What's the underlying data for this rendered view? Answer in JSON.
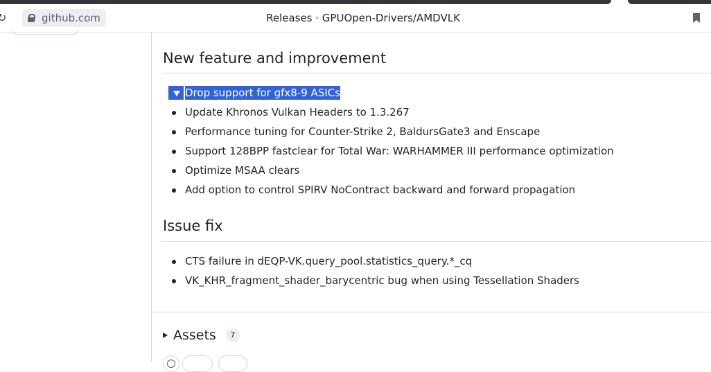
{
  "browser": {
    "url": "github.com",
    "page_title": "Releases · GPUOpen-Drivers/AMDVLK"
  },
  "sections": {
    "features": {
      "heading": "New feature and improvement",
      "items": [
        "Drop support for gfx8-9 ASICs",
        "Update Khronos Vulkan Headers to 1.3.267",
        "Performance tuning for Counter-Strike 2, BaldursGate3 and Enscape",
        "Support 128BPP fastclear for Total War: WARHAMMER III performance optimization",
        "Optimize MSAA clears",
        "Add option to control SPIRV NoContract backward and forward propagation"
      ]
    },
    "fixes": {
      "heading": "Issue fix",
      "items": [
        "CTS failure in dEQP-VK.query_pool.statistics_query.*_cq",
        "VK_KHR_fragment_shader_barycentric bug when using Tessellation Shaders"
      ]
    }
  },
  "assets": {
    "label": "Assets",
    "count": "7"
  },
  "colors": {
    "selection": "#3263d6",
    "text": "#1f2328",
    "border": "#d0d7de"
  },
  "icons": [
    "reload-icon",
    "lock-icon",
    "bookmark-icon",
    "caret-right-icon",
    "smiley-icon"
  ]
}
